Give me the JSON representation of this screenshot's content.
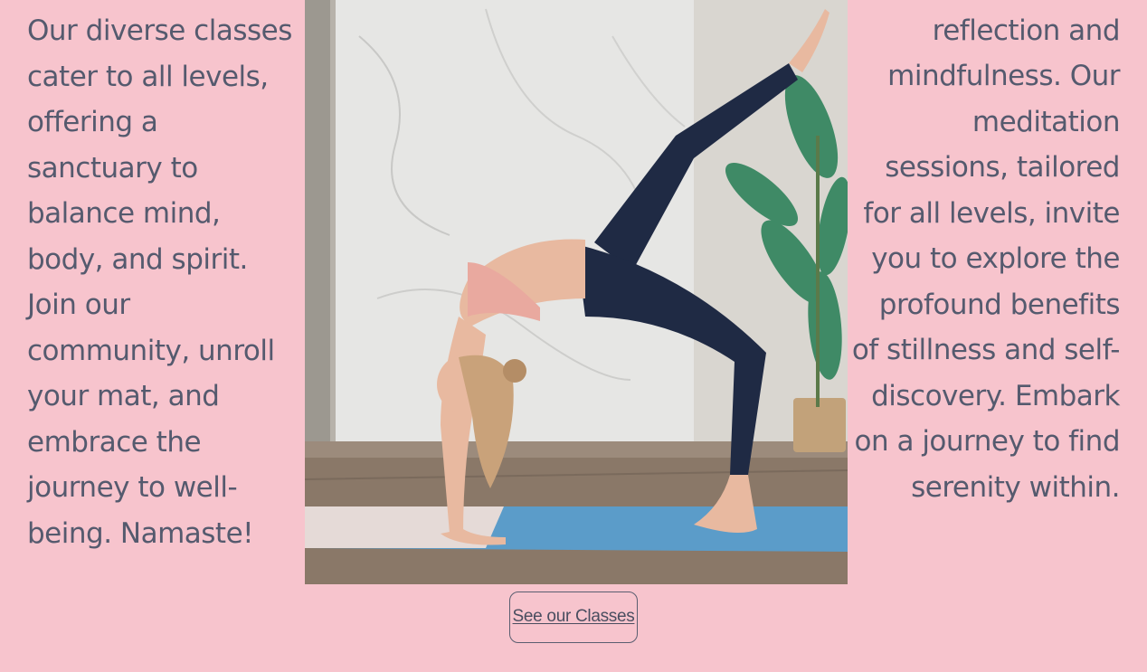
{
  "left_text": "Our diverse classes cater to all levels, offering a sanctuary to balance mind, body, and spirit. Join our community, unroll your mat, and embrace the journey to well-being. Namaste!",
  "right_text": "designed for inner reflection and mindfulness. Our meditation sessions, tailored for all levels, invite you to explore the profound benefits of stillness and self-discovery. Embark on a journey to find serenity within.",
  "photo_icon": "yoga-photo",
  "cta": {
    "label": "See our Classes"
  },
  "colors": {
    "background": "#f7c4cd",
    "text": "#555a6e",
    "button_border": "#5a5e70"
  }
}
